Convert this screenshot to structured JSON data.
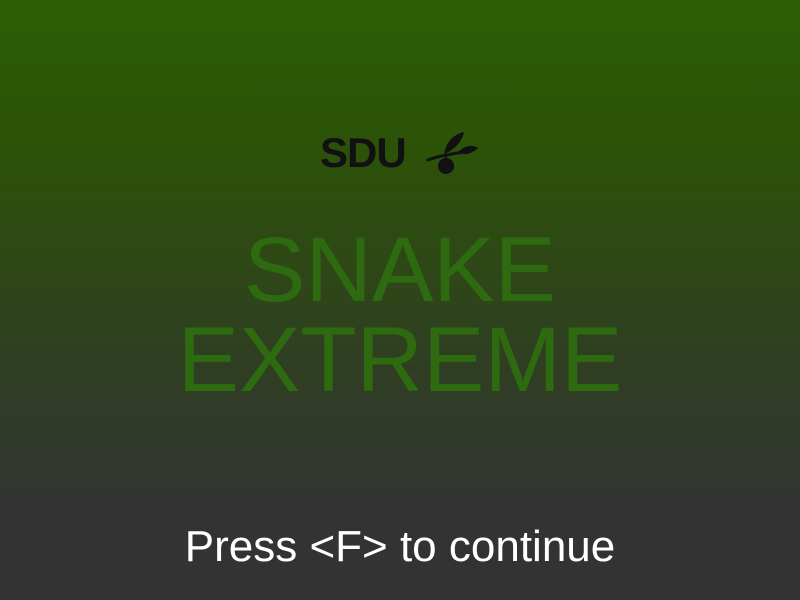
{
  "logo": {
    "text": "SDU",
    "icon": "leaf-apple-icon",
    "color": "#111111"
  },
  "title": {
    "line1": "SNAKE",
    "line2": "EXTREME",
    "color": "#2e6a10"
  },
  "prompt": {
    "text": "Press <F> to continue",
    "color": "#ffffff"
  },
  "colors": {
    "background_top": "#2c5e05",
    "background_bottom": "#333333"
  }
}
